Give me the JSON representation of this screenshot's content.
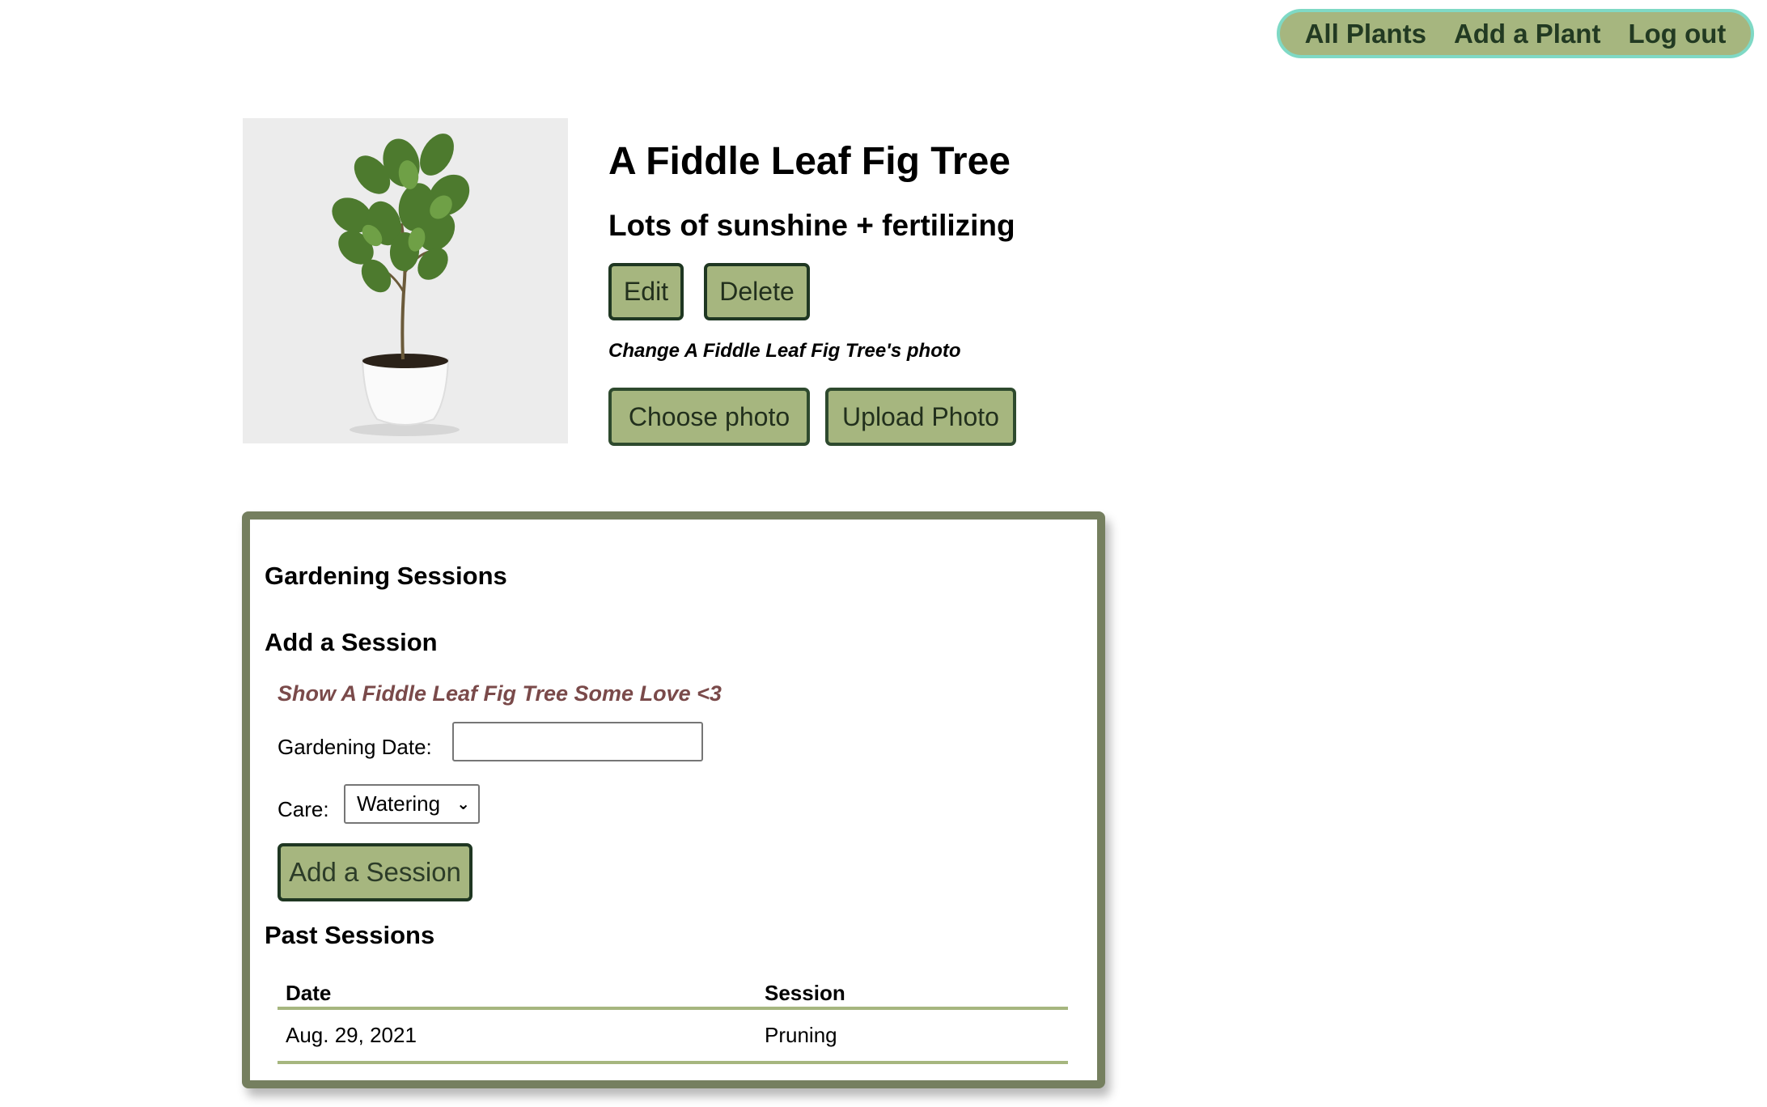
{
  "nav": {
    "all_plants": "All Plants",
    "add_plant": "Add a Plant",
    "log_out": "Log out"
  },
  "plant": {
    "image_icon": "potted-fiddle-leaf-fig-image",
    "title": "A Fiddle Leaf Fig Tree",
    "subtitle": "Lots of sunshine + fertilizing",
    "edit_label": "Edit",
    "delete_label": "Delete",
    "photo_caption": "Change A Fiddle Leaf Fig Tree's photo",
    "choose_photo_label": "Choose photo",
    "upload_photo_label": "Upload Photo"
  },
  "sessions": {
    "heading": "Gardening Sessions",
    "add_heading": "Add a Session",
    "love_text": "Show A Fiddle Leaf Fig Tree Some Love <3",
    "date_label": "Gardening Date:",
    "date_value": "",
    "care_label": "Care:",
    "care_selected": "Watering",
    "add_button_label": "Add a Session",
    "past_heading": "Past Sessions",
    "columns": [
      "Date",
      "Session"
    ],
    "rows": [
      {
        "date": "Aug. 29, 2021",
        "session": "Pruning"
      }
    ]
  },
  "colors": {
    "accent_green": "#a6b67f",
    "panel_border": "#757f5f",
    "nav_border": "#7fd9c5",
    "love_text": "#7a4a4a"
  }
}
